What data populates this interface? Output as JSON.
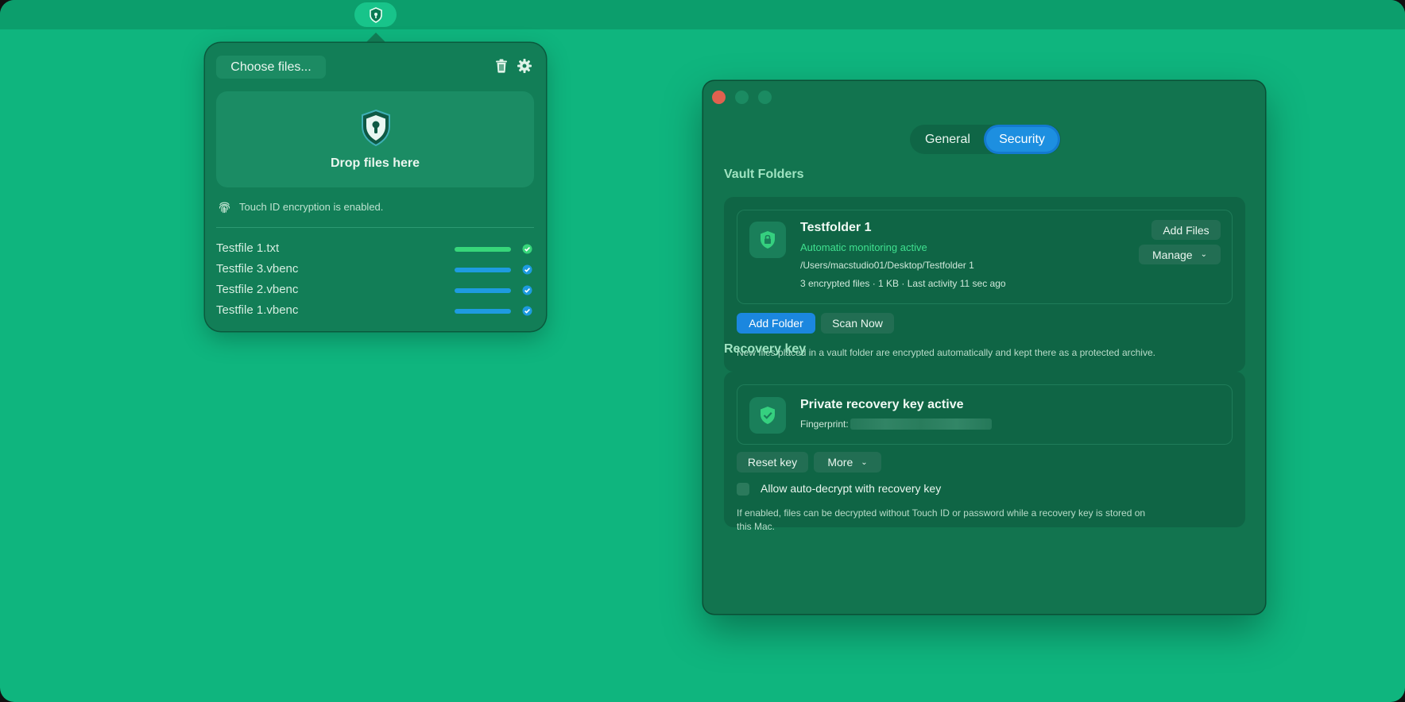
{
  "menubar": {
    "app_icon": "shield-keyhole-icon"
  },
  "popover": {
    "choose_files_label": "Choose files...",
    "dropzone_label": "Drop files here",
    "touchid_status": "Touch ID encryption is enabled.",
    "files": [
      {
        "name": "Testfile 1.txt",
        "progress": 1.0,
        "color": "#37d67a",
        "check_color": "#37d67a"
      },
      {
        "name": "Testfile 3.vbenc",
        "progress": 1.0,
        "color": "#1e9be0",
        "check_color": "#1e9be0"
      },
      {
        "name": "Testfile 2.vbenc",
        "progress": 1.0,
        "color": "#1e9be0",
        "check_color": "#1e9be0"
      },
      {
        "name": "Testfile 1.vbenc",
        "progress": 1.0,
        "color": "#1e9be0",
        "check_color": "#1e9be0"
      }
    ]
  },
  "window": {
    "tabs": {
      "general": "General",
      "security": "Security",
      "selected": "Security"
    },
    "vault": {
      "section_title": "Vault Folders",
      "folder_name": "Testfolder 1",
      "status": "Automatic monitoring active",
      "path": "/Users/macstudio01/Desktop/Testfolder 1",
      "stats": "3 encrypted files · 1 KB · Last activity 11 sec ago",
      "add_files_label": "Add Files",
      "manage_label": "Manage",
      "add_folder_label": "Add Folder",
      "scan_now_label": "Scan Now",
      "note": "New files placed in a vault folder are encrypted automatically and kept there as a protected archive."
    },
    "recovery": {
      "section_title": "Recovery key",
      "title": "Private recovery key active",
      "fingerprint_label": "Fingerprint:",
      "reset_label": "Reset key",
      "more_label": "More",
      "checkbox_label": "Allow auto-decrypt with recovery key",
      "checkbox_checked": false,
      "note_line1": "If enabled, files can be decrypted without Touch ID or password while a recovery key is stored on",
      "note_line2": "this Mac."
    }
  },
  "colors": {
    "desktop": "#0fb57e",
    "accent": "#1b87df",
    "success": "#3fe08f"
  }
}
